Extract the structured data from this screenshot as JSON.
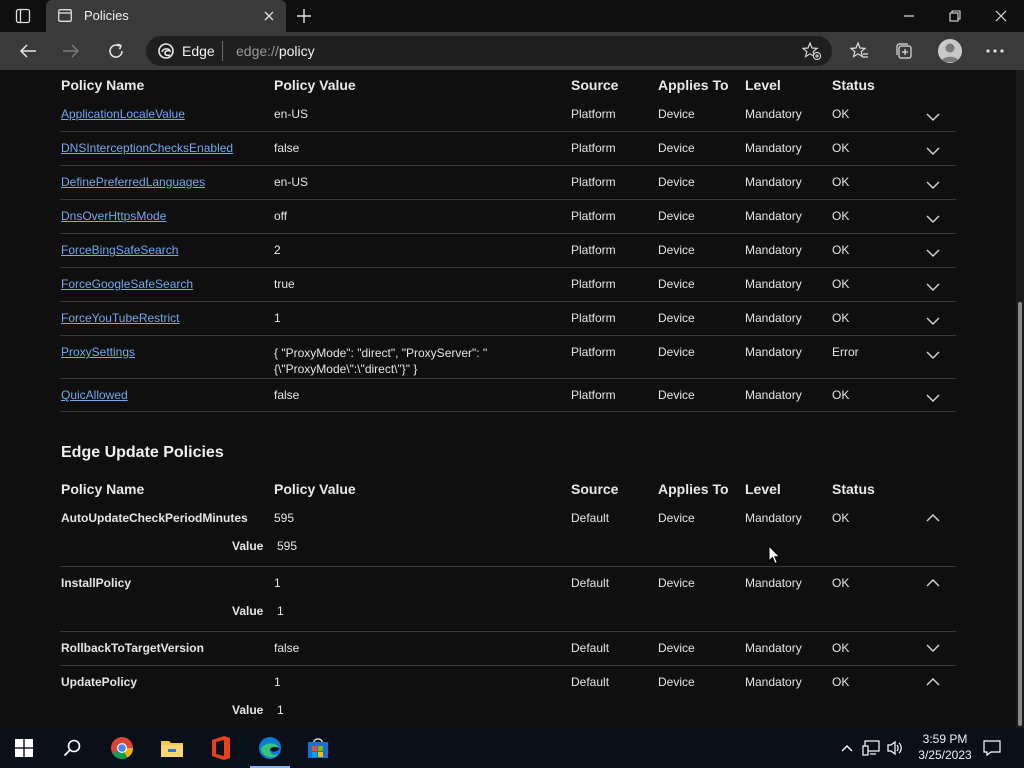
{
  "browser": {
    "tab_title": "Policies",
    "address_site": "Edge",
    "address_url_prefix": "edge://",
    "address_url_path": "policy"
  },
  "table_headers": {
    "policy_name": "Policy Name",
    "policy_value": "Policy Value",
    "source": "Source",
    "applies_to": "Applies To",
    "level": "Level",
    "status": "Status"
  },
  "top_rows": [
    {
      "name": "ApplicationLocaleValue",
      "value": "en-US",
      "source": "Platform",
      "applies": "Device",
      "level": "Mandatory",
      "status": "OK"
    },
    {
      "name": "DNSInterceptionChecksEnabled",
      "value": "false",
      "source": "Platform",
      "applies": "Device",
      "level": "Mandatory",
      "status": "OK"
    },
    {
      "name": "DefinePreferredLanguages",
      "value": "en-US",
      "source": "Platform",
      "applies": "Device",
      "level": "Mandatory",
      "status": "OK"
    },
    {
      "name": "DnsOverHttpsMode",
      "value": "off",
      "source": "Platform",
      "applies": "Device",
      "level": "Mandatory",
      "status": "OK"
    },
    {
      "name": "ForceBingSafeSearch",
      "value": "2",
      "source": "Platform",
      "applies": "Device",
      "level": "Mandatory",
      "status": "OK"
    },
    {
      "name": "ForceGoogleSafeSearch",
      "value": "true",
      "source": "Platform",
      "applies": "Device",
      "level": "Mandatory",
      "status": "OK"
    },
    {
      "name": "ForceYouTubeRestrict",
      "value": "1",
      "source": "Platform",
      "applies": "Device",
      "level": "Mandatory",
      "status": "OK"
    },
    {
      "name": "ProxySettings",
      "value": "{ \"ProxyMode\": \"direct\", \"ProxyServer\": \"{\\\"ProxyMode\\\":\\\"direct\\\"}\" }",
      "source": "Platform",
      "applies": "Device",
      "level": "Mandatory",
      "status": "Error"
    },
    {
      "name": "QuicAllowed",
      "value": "false",
      "source": "Platform",
      "applies": "Device",
      "level": "Mandatory",
      "status": "OK"
    }
  ],
  "update_section": {
    "title": "Edge Update Policies",
    "value_label": "Value",
    "rows": [
      {
        "name": "AutoUpdateCheckPeriodMinutes",
        "value": "595",
        "source": "Default",
        "applies": "Device",
        "level": "Mandatory",
        "status": "OK",
        "expanded": true,
        "detail_value": "595"
      },
      {
        "name": "InstallPolicy",
        "value": "1",
        "source": "Default",
        "applies": "Device",
        "level": "Mandatory",
        "status": "OK",
        "expanded": true,
        "detail_value": "1"
      },
      {
        "name": "RollbackToTargetVersion",
        "value": "false",
        "source": "Default",
        "applies": "Device",
        "level": "Mandatory",
        "status": "OK",
        "expanded": false
      },
      {
        "name": "UpdatePolicy",
        "value": "1",
        "source": "Default",
        "applies": "Device",
        "level": "Mandatory",
        "status": "OK",
        "expanded": true,
        "detail_value": "1"
      }
    ]
  },
  "taskbar": {
    "time": "3:59 PM",
    "date": "3/25/2023",
    "icons": [
      "start-icon",
      "search-icon",
      "chrome-icon",
      "file-explorer-icon",
      "office-icon",
      "edge-icon",
      "store-icon"
    ]
  },
  "colors": {
    "link": "#73a9f0",
    "background": "#0f0f0f",
    "toolbar": "#3a3a3a"
  }
}
